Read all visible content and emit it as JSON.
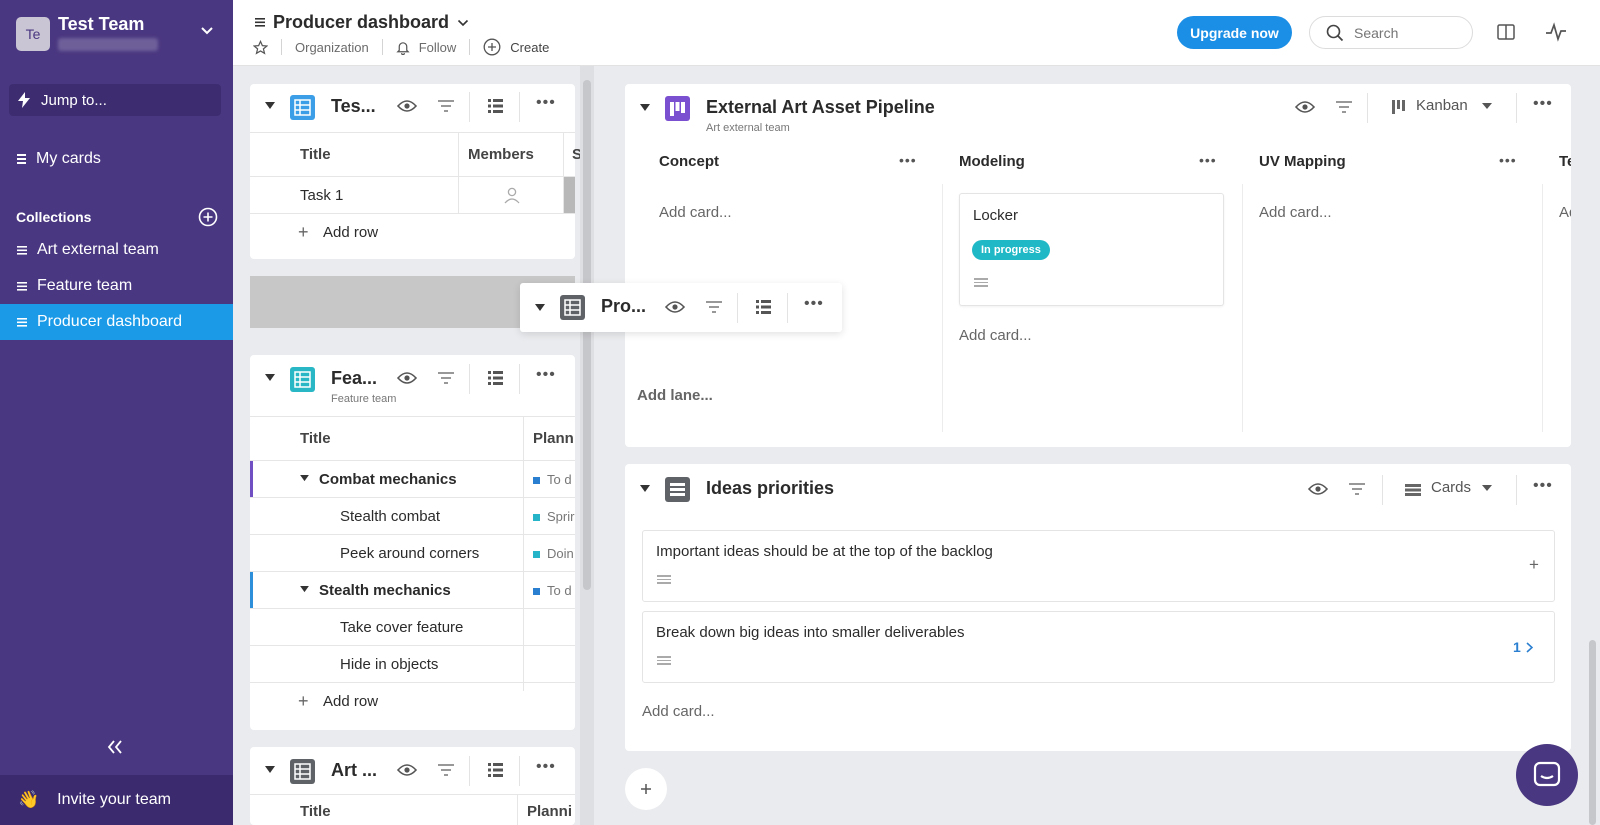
{
  "sidebar": {
    "team_initials": "Te",
    "team_name": "Test Team",
    "jump_to": "Jump to...",
    "my_cards": "My cards",
    "collections_label": "Collections",
    "items": [
      {
        "label": "Art external team"
      },
      {
        "label": "Feature team"
      },
      {
        "label": "Producer dashboard"
      }
    ],
    "invite": "Invite your team",
    "colors": {
      "bg": "#4a3781",
      "active": "#1b9ae8"
    }
  },
  "header": {
    "title": "Producer dashboard",
    "organization": "Organization",
    "follow": "Follow",
    "create": "Create",
    "upgrade": "Upgrade now",
    "search_placeholder": "Search"
  },
  "left_panels": {
    "test": {
      "title": "Tes...",
      "columns": [
        "Title",
        "Members",
        "S"
      ],
      "rows": [
        {
          "title": "Task 1"
        }
      ],
      "add_row": "Add row"
    },
    "floating": {
      "title": "Pro..."
    },
    "feature": {
      "title": "Fea...",
      "subtitle": "Feature team",
      "columns": [
        "Title",
        "Plann"
      ],
      "rows": [
        {
          "title": "Combat mechanics",
          "status": "To d",
          "status_color": "#2b7fd0"
        },
        {
          "title": "Stealth combat",
          "status": "Sprir",
          "status_color": "#26b5c8"
        },
        {
          "title": "Peek around corners",
          "status": "Doin",
          "status_color": "#26b5c8"
        },
        {
          "title": "Stealth mechanics",
          "status": "To d",
          "status_color": "#2b7fd0"
        },
        {
          "title": "Take cover feature",
          "status": ""
        },
        {
          "title": "Hide in objects",
          "status": ""
        }
      ],
      "add_row": "Add row"
    },
    "art": {
      "title": "Art ...",
      "columns": [
        "Title",
        "Planni"
      ]
    }
  },
  "kanban": {
    "title": "External Art Asset Pipeline",
    "subtitle": "Art external team",
    "view": "Kanban",
    "lanes": [
      {
        "title": "Concept",
        "add_card": "Add card..."
      },
      {
        "title": "Modeling",
        "card": "Locker",
        "badge": "In progress",
        "add_card": "Add card..."
      },
      {
        "title": "UV Mapping",
        "add_card": "Add card..."
      },
      {
        "title": "Te",
        "add_card": "Ad"
      }
    ],
    "add_lane": "Add lane...",
    "accent": "#7a4fd0",
    "badge_color": "#1fb8c6"
  },
  "ideas": {
    "title": "Ideas priorities",
    "view": "Cards",
    "cards": [
      {
        "title": "Important ideas should be at the top of the backlog",
        "action": "+"
      },
      {
        "title": "Break down big ideas into smaller deliverables",
        "count": "1"
      }
    ],
    "add_card": "Add card..."
  },
  "icons": {
    "table": "table-icon",
    "kanban": "kanban-icon",
    "eye": "eye-icon",
    "filter": "filter-icon",
    "more": "more-icon",
    "chat": "chat-icon"
  }
}
